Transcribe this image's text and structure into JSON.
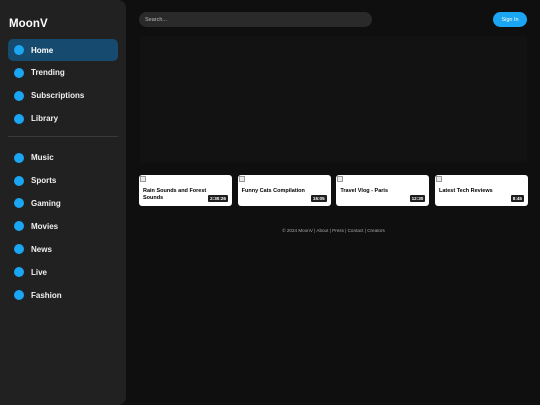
{
  "app": {
    "logo": "MoonV"
  },
  "sidebar": {
    "primary": [
      {
        "label": "Home",
        "active": true
      },
      {
        "label": "Trending"
      },
      {
        "label": "Subscriptions"
      },
      {
        "label": "Library"
      }
    ],
    "categories": [
      {
        "label": "Music"
      },
      {
        "label": "Sports"
      },
      {
        "label": "Gaming"
      },
      {
        "label": "Movies"
      },
      {
        "label": "News"
      },
      {
        "label": "Live"
      },
      {
        "label": "Fashion"
      }
    ]
  },
  "header": {
    "search_placeholder": "Search...",
    "signin_label": "Sign In"
  },
  "videos": [
    {
      "title": "Rain Sounds and Forest Sounds",
      "duration": "2:30:26"
    },
    {
      "title": "Funny Cats Compilation",
      "duration": "15:05"
    },
    {
      "title": "Travel Vlog - Paris",
      "duration": "12:30"
    },
    {
      "title": "Latest Tech Reviews",
      "duration": "8:45"
    }
  ],
  "footer": {
    "text": "© 2024 MoonV | About | Press | Contact | Creators"
  },
  "colors": {
    "accent": "#1aa6f2",
    "active_bg": "#164a6e",
    "sidebar_bg": "#212121",
    "page_bg": "#0f0f0f"
  },
  "icons": {
    "nav": "circle-icon",
    "thumbnail": "broken-image-icon"
  }
}
